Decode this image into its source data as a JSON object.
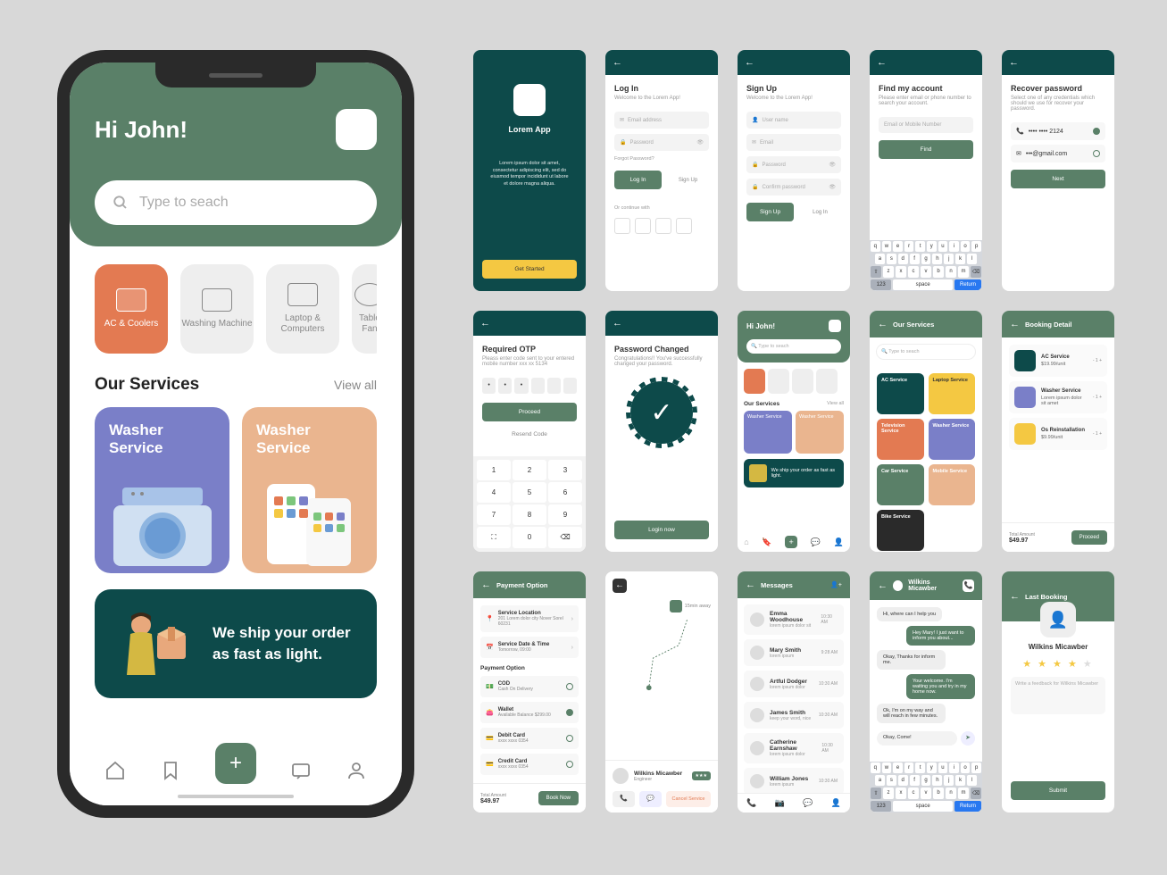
{
  "main": {
    "greeting": "Hi John!",
    "search_placeholder": "Type to seach",
    "categories": [
      {
        "label": "AC & Coolers",
        "active": true
      },
      {
        "label": "Washing Machine",
        "active": false
      },
      {
        "label": "Laptop & Computers",
        "active": false
      },
      {
        "label": "Table Fan",
        "active": false
      }
    ],
    "services_heading": "Our Services",
    "view_all": "View all",
    "service_cards": [
      {
        "title": "Washer Service",
        "color": "blue"
      },
      {
        "title": "Washer Service",
        "color": "peach"
      }
    ],
    "banner_text": "We ship your order as fast as light."
  },
  "screens": {
    "splash": {
      "app_name": "Lorem App",
      "description": "Lorem ipsum dolor sit amet, consectetur adipiscing elit, sed do eiusmod tempor incididunt ut labore et dolore magna aliqua.",
      "cta": "Get Started"
    },
    "login": {
      "title": "Log In",
      "subtitle": "Welcome to the Lorem App!",
      "email": "Email address",
      "password": "Password",
      "forgot": "Forgot Password?",
      "btn": "Log In",
      "alt": "Sign Up",
      "continue": "Or continue with"
    },
    "signup": {
      "title": "Sign Up",
      "subtitle": "Welcome to the Lorem App!",
      "username": "User name",
      "email": "Email",
      "password": "Password",
      "confirm": "Confirm password",
      "btn": "Sign Up",
      "alt": "Log In"
    },
    "find": {
      "title": "Find my account",
      "subtitle": "Please enter email or phone number to search your account.",
      "placeholder": "Email or Mobile Number",
      "btn": "Find"
    },
    "recover": {
      "title": "Recover password",
      "subtitle": "Select one of any credentials which should we use for recover your password.",
      "opt1": "•••• •••• 2124",
      "opt2": "•••@gmail.com",
      "btn": "Next"
    },
    "otp": {
      "title": "Required OTP",
      "subtitle": "Pleass enter code sent to your entered mobile number xxx xx 5134",
      "btn": "Proceed",
      "resend": "Resend Code"
    },
    "pwchanged": {
      "title": "Password Changed",
      "subtitle": "Congratulations!! You've successfully changed your password.",
      "btn": "Login now"
    },
    "home_mini": {
      "greeting": "Hi John!",
      "search": "Type to seach",
      "services": "Our Services",
      "view_all": "View all",
      "card1": "Washer Service",
      "card2": "Washer Service",
      "banner": "We ship your order as fast as light."
    },
    "our_services": {
      "title": "Our Services",
      "items": [
        "AC Service",
        "Laptop Service",
        "Television Service",
        "Washer Service",
        "Car Service",
        "Mobile Service",
        "Bike Service"
      ]
    },
    "booking": {
      "title": "Booking Detail",
      "items": [
        {
          "name": "AC Service",
          "price": "$19.99/unit"
        },
        {
          "name": "Washer Service",
          "price": "Lorem ipsum dolor sit amet"
        },
        {
          "name": "Os Reinstallation",
          "price": "$9.99/unit"
        }
      ],
      "total_label": "Total Amount",
      "total": "$49.97",
      "btn": "Proceed"
    },
    "payment": {
      "title": "Payment Option",
      "loc_label": "Service Location",
      "loc": "201 Lorem dolor city Nover Sorel 60231",
      "date_label": "Service Date & Time",
      "date": "Tomorrow, 09:00",
      "section": "Payment Option",
      "methods": [
        {
          "name": "COD",
          "sub": "Cash On Delivery"
        },
        {
          "name": "Wallet",
          "sub": "Available Balance $299.00"
        },
        {
          "name": "Debit Card",
          "sub": "xxxx xxxx 0354"
        },
        {
          "name": "Credit Card",
          "sub": "xxxx xxxx 0354"
        }
      ],
      "total_label": "Total Amount",
      "total": "$49.97",
      "btn": "Book Now"
    },
    "tracking": {
      "distance": "15min away",
      "provider": "Wilkins Micawber",
      "role": "Engineer",
      "cancel": "Cancel Service"
    },
    "messages": {
      "title": "Messages",
      "items": [
        {
          "name": "Emma Woodhouse",
          "time": "10:30 AM"
        },
        {
          "name": "Mary Smith",
          "time": "9:28 AM"
        },
        {
          "name": "Artful Dodger",
          "time": "10:30 AM"
        },
        {
          "name": "James Smith",
          "time": "10:30 AM"
        },
        {
          "name": "Catherine Earnshaw",
          "time": "10:30 AM"
        },
        {
          "name": "William Jones",
          "time": "10:30 AM"
        }
      ]
    },
    "chat": {
      "name": "Wilkins Micawber",
      "msgs": [
        {
          "t": "Hi, where can I help you",
          "d": "in"
        },
        {
          "t": "Hey Mary! I just want to inform you about...",
          "d": "out"
        },
        {
          "t": "Okay, Thanks for inform me.",
          "d": "in"
        },
        {
          "t": "Your welcome. I'm waiting you and try in my home now.",
          "d": "out"
        },
        {
          "t": "Ok, I'm on my way and will reach in few minutes.",
          "d": "in"
        }
      ],
      "input": "Okay, Come!"
    },
    "feedback": {
      "title": "Last Booking",
      "name": "Wilkins Micawber",
      "placeholder": "Write a feedback for Wilkins Micawber",
      "btn": "Submit"
    }
  },
  "keyboard": {
    "row1": [
      "q",
      "w",
      "e",
      "r",
      "t",
      "y",
      "u",
      "i",
      "o",
      "p"
    ],
    "row2": [
      "a",
      "s",
      "d",
      "f",
      "g",
      "h",
      "j",
      "k",
      "l"
    ],
    "row3": [
      "⇧",
      "z",
      "x",
      "c",
      "v",
      "b",
      "n",
      "m",
      "⌫"
    ],
    "row4": [
      "123",
      "space",
      "Return"
    ]
  }
}
